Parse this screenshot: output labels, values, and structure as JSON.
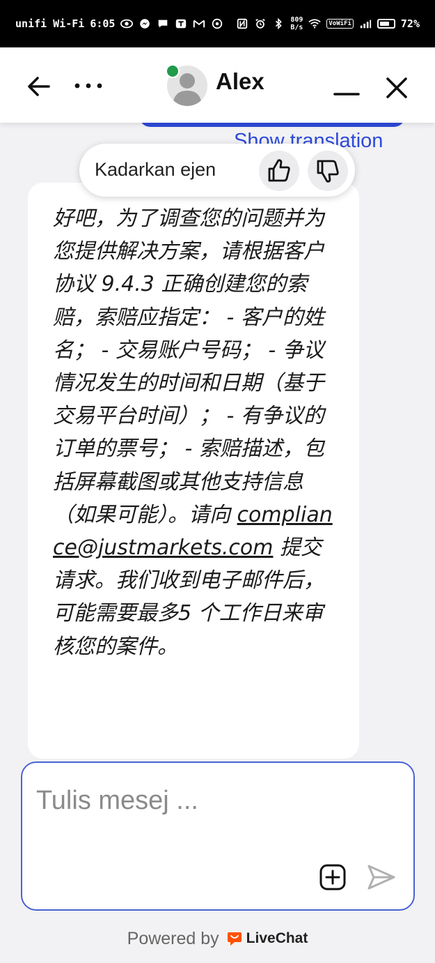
{
  "status_bar": {
    "carrier": "unifi Wi-Fi",
    "time": "6:05",
    "speed_value": "809",
    "speed_unit": "B/s",
    "vowifi": "VoWiFi",
    "battery": "72%",
    "battery_level": 0.72
  },
  "header": {
    "agent_name": "Alex",
    "online_color": "#219b4c"
  },
  "previous_message": {
    "translation_link": "Show translation"
  },
  "rating": {
    "label": "Kadarkan ejen"
  },
  "message": {
    "text_before_link": "好吧，为了调查您的问题并为您提供解决方案，请根据客户协议 9.4.3 正确创建您的索赔，索赔应指定： - 客户的姓名； - 交易账户号码； - 争议情况发生的时间和日期（基于交易平台时间）； - 有争议的订单的票号； - 索赔描述，包括屏幕截图或其他支持信息（如果可能）。请向 ",
    "link_text": "compliance@justmarkets.com",
    "text_after_link": " 提交请求。我们收到电子邮件后，可能需要最多5 个工作日来审核您的案件。"
  },
  "composer": {
    "placeholder": "Tulis mesej ..."
  },
  "footer": {
    "powered_by": "Powered by",
    "brand": "LiveChat",
    "brand_color": "#ff5100"
  },
  "colors": {
    "accent": "#2d4ad9",
    "composer_border": "#4862d6"
  }
}
